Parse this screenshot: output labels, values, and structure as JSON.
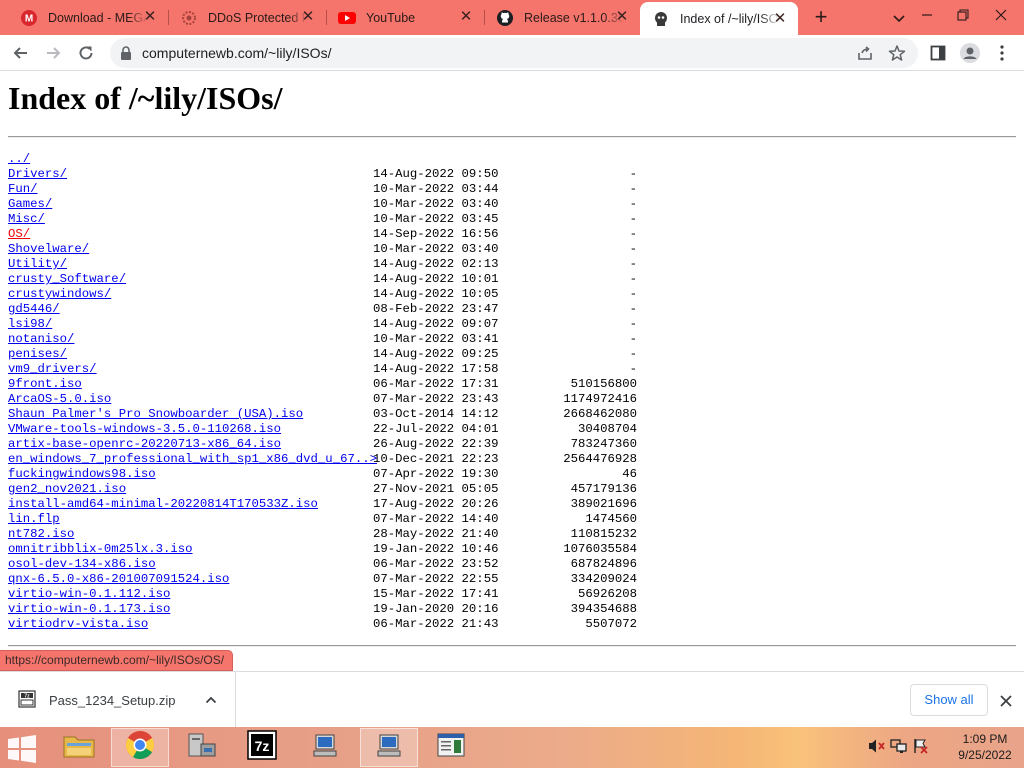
{
  "tabs": [
    {
      "title": "Download - MEGA",
      "icon": "mega-icon",
      "active": false
    },
    {
      "title": "DDoS Protected Page",
      "icon": "ddos-guard-icon",
      "active": false
    },
    {
      "title": "YouTube",
      "icon": "youtube-icon",
      "active": false
    },
    {
      "title": "Release v1.1.0.364",
      "icon": "github-icon",
      "active": false
    },
    {
      "title": "Index of /~lily/ISOs/",
      "icon": "tab-page-icon",
      "active": true
    }
  ],
  "address_bar": {
    "url": "computernewb.com/~lily/ISOs/"
  },
  "page": {
    "title": "Index of /~lily/ISOs/",
    "parent_link": "../",
    "entries": [
      {
        "name": "Drivers/",
        "date": "14-Aug-2022 09:50",
        "size": "-"
      },
      {
        "name": "Fun/",
        "date": "10-Mar-2022 03:44",
        "size": "-"
      },
      {
        "name": "Games/",
        "date": "10-Mar-2022 03:40",
        "size": "-"
      },
      {
        "name": "Misc/",
        "date": "10-Mar-2022 03:45",
        "size": "-"
      },
      {
        "name": "OS/",
        "date": "14-Sep-2022 16:56",
        "size": "-"
      },
      {
        "name": "Shovelware/",
        "date": "10-Mar-2022 03:40",
        "size": "-"
      },
      {
        "name": "Utility/",
        "date": "14-Aug-2022 02:13",
        "size": "-"
      },
      {
        "name": "crusty_Software/",
        "date": "14-Aug-2022 10:01",
        "size": "-"
      },
      {
        "name": "crustywindows/",
        "date": "14-Aug-2022 10:05",
        "size": "-"
      },
      {
        "name": "gd5446/",
        "date": "08-Feb-2022 23:47",
        "size": "-"
      },
      {
        "name": "lsi98/",
        "date": "14-Aug-2022 09:07",
        "size": "-"
      },
      {
        "name": "notaniso/",
        "date": "10-Mar-2022 03:41",
        "size": "-"
      },
      {
        "name": "penises/",
        "date": "14-Aug-2022 09:25",
        "size": "-"
      },
      {
        "name": "vm9_drivers/",
        "date": "14-Aug-2022 17:58",
        "size": "-"
      },
      {
        "name": "9front.iso",
        "date": "06-Mar-2022 17:31",
        "size": "510156800"
      },
      {
        "name": "ArcaOS-5.0.iso",
        "date": "07-Mar-2022 23:43",
        "size": "1174972416"
      },
      {
        "name": "Shaun Palmer's Pro Snowboarder (USA).iso",
        "date": "03-Oct-2014 14:12",
        "size": "2668462080"
      },
      {
        "name": "VMware-tools-windows-3.5.0-110268.iso",
        "date": "22-Jul-2022 04:01",
        "size": "30408704"
      },
      {
        "name": "artix-base-openrc-20220713-x86_64.iso",
        "date": "26-Aug-2022 22:39",
        "size": "783247360"
      },
      {
        "name": "en_windows_7_professional_with_sp1_x86_dvd_u_67..>",
        "date": "10-Dec-2021 22:23",
        "size": "2564476928"
      },
      {
        "name": "fuckingwindows98.iso",
        "date": "07-Apr-2022 19:30",
        "size": "46"
      },
      {
        "name": "gen2_nov2021.iso",
        "date": "27-Nov-2021 05:05",
        "size": "457179136"
      },
      {
        "name": "install-amd64-minimal-20220814T170533Z.iso",
        "date": "17-Aug-2022 20:26",
        "size": "389021696"
      },
      {
        "name": "lin.flp",
        "date": "07-Mar-2022 14:40",
        "size": "1474560"
      },
      {
        "name": "nt782.iso",
        "date": "28-May-2022 21:40",
        "size": "110815232"
      },
      {
        "name": "omnitribblix-0m25lx.3.iso",
        "date": "19-Jan-2022 10:46",
        "size": "1076035584"
      },
      {
        "name": "osol-dev-134-x86.iso",
        "date": "06-Mar-2022 23:52",
        "size": "687824896"
      },
      {
        "name": "qnx-6.5.0-x86-201007091524.iso",
        "date": "07-Mar-2022 22:55",
        "size": "334209024"
      },
      {
        "name": "virtio-win-0.1.112.iso",
        "date": "15-Mar-2022 17:41",
        "size": "56926208"
      },
      {
        "name": "virtio-win-0.1.173.iso",
        "date": "19-Jan-2020 20:16",
        "size": "394354688"
      },
      {
        "name": "virtiodrv-vista.iso",
        "date": "06-Mar-2022 21:43",
        "size": "5507072"
      }
    ]
  },
  "status_bar": {
    "hover_url": "https://computernewb.com/~lily/ISOs/OS/"
  },
  "download_shelf": {
    "filename": "Pass_1234_Setup.zip",
    "show_all_label": "Show all"
  },
  "taskbar": {
    "items": [
      "file-explorer-icon",
      "chrome-icon",
      "computer-tool-icon",
      "7zip-icon",
      "monitor-app-icon",
      "monitor-app-icon",
      "window-app-icon"
    ],
    "clock_time": "1:09 PM",
    "clock_date": "9/25/2022"
  },
  "colors": {
    "tabstrip": "#f5756c",
    "link": "#0000ee",
    "link_hover": "#ee0000",
    "link_visited": "#551a8b"
  }
}
